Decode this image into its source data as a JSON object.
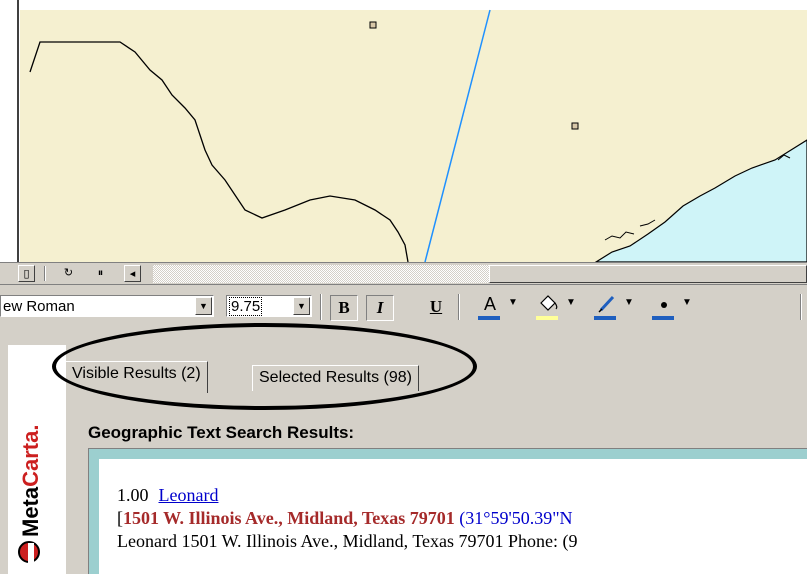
{
  "map": {
    "land_color": "#f5f0d0",
    "sea_color": "#cff4f8",
    "river_color": "#1e90ff",
    "border_color": "#000000"
  },
  "map_toolbar": {
    "icons": [
      "page-icon",
      "refresh-icon",
      "pause-icon",
      "scroll-left-arrow-icon"
    ],
    "page_glyph": "▯",
    "refresh_glyph": "↻",
    "pause_glyph": "⏸",
    "left_arrow_glyph": "◂"
  },
  "format_toolbar": {
    "font_name": "ew Roman",
    "font_size": "9.75",
    "bold_label": "B",
    "italic_label": "I",
    "underline_label": "U",
    "font_color_glyph": "A",
    "dropdown_glyph": "▼",
    "font_color": "#1f5fbf",
    "fill_color": "#ffff99",
    "line_color": "#1f5fbf",
    "marker_color": "#1f5fbf"
  },
  "brand": {
    "meta": "Meta",
    "carta": "Carta",
    "registered": "."
  },
  "tabs": [
    {
      "label": "Visible Results (2)",
      "active": true
    },
    {
      "label": "Selected Results (98)",
      "active": false
    }
  ],
  "results": {
    "title": "Geographic Text Search Results:",
    "items": [
      {
        "score": "1.00",
        "name": "Leonard",
        "bracket_open": "[",
        "address": "1501 W. Illinois Ave., Midland, Texas 79701",
        "coords": "(31°59'50.39\"N",
        "snippet": "Leonard 1501 W. Illinois Ave., Midland, Texas 79701 Phone: (9"
      }
    ]
  }
}
